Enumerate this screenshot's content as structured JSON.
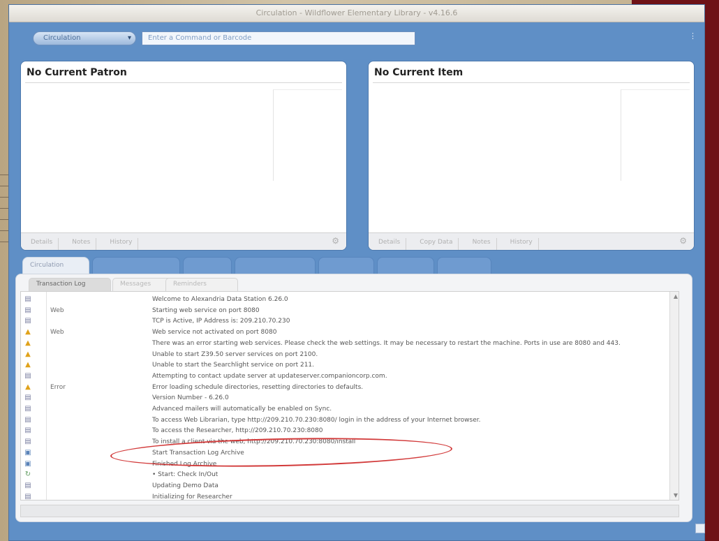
{
  "window": {
    "title": "Circulation - Wildflower Elementary Library - v4.16.6",
    "left_label": ""
  },
  "command_bar": {
    "select_label": "Circulation",
    "input_placeholder": "Enter a Command or Barcode",
    "more_icon": "ellipsis-icon"
  },
  "patron_panel": {
    "title": "No Current Patron",
    "buttons": [
      "Details",
      "Notes",
      "History"
    ],
    "gear_icon": "gear-icon"
  },
  "item_panel": {
    "title": "No Current Item",
    "buttons": [
      "Details",
      "Copy Data",
      "Notes",
      "History"
    ],
    "gear_icon": "gear-icon"
  },
  "tabs": [
    {
      "label": "Circulation",
      "active": true
    },
    {
      "label": "",
      "active": false
    },
    {
      "label": "",
      "active": false
    },
    {
      "label": "",
      "active": false
    },
    {
      "label": "",
      "active": false
    },
    {
      "label": "",
      "active": false
    },
    {
      "label": "",
      "active": false
    }
  ],
  "subtabs": [
    {
      "label": "Transaction Log",
      "active": true
    },
    {
      "label": "Messages",
      "active": false
    },
    {
      "label": "Reminders",
      "active": false
    }
  ],
  "log": [
    {
      "icon": "info-icon",
      "category": "",
      "message": "Welcome to Alexandria Data Station 6.26.0"
    },
    {
      "icon": "info-icon",
      "category": "Web",
      "message": "Starting web service on port 8080"
    },
    {
      "icon": "info-icon",
      "category": "",
      "message": "TCP is Active, IP Address is: 209.210.70.230"
    },
    {
      "icon": "warning-icon",
      "category": "Web",
      "message": "Web service not activated on port 8080"
    },
    {
      "icon": "warning-icon",
      "category": "",
      "message": "There was an error starting web services. Please check the web settings. It may be necessary to restart the machine. Ports in use are 8080 and 443."
    },
    {
      "icon": "warning-icon",
      "category": "",
      "message": "Unable to start Z39.50 server services on port 2100."
    },
    {
      "icon": "warning-icon",
      "category": "",
      "message": "Unable to start the Searchlight service on port 211."
    },
    {
      "icon": "info-icon",
      "category": "",
      "message": "Attempting to contact update server at updateserver.companioncorp.com."
    },
    {
      "icon": "warning-icon",
      "category": "Error",
      "message": "Error loading schedule directories, resetting directories to defaults."
    },
    {
      "icon": "info-icon",
      "category": "",
      "message": "Version Number - 6.26.0"
    },
    {
      "icon": "info-icon",
      "category": "",
      "message": "Advanced mailers will automatically be enabled on Sync."
    },
    {
      "icon": "info-icon",
      "category": "",
      "message": "To access Web Librarian, type http://209.210.70.230:8080/ login in the address of your Internet browser."
    },
    {
      "icon": "info-icon",
      "category": "",
      "message": "To access the Researcher, http://209.210.70.230:8080"
    },
    {
      "icon": "info-icon",
      "category": "",
      "message": "To install a client via the web, http://209.210.70.230:8080/install"
    },
    {
      "icon": "disk-icon",
      "category": "",
      "message": "Start Transaction Log Archive"
    },
    {
      "icon": "disk-icon",
      "category": "",
      "message": "Finished Log Archive"
    },
    {
      "icon": "checkout-icon",
      "category": "",
      "message": "• Start: Check In/Out"
    },
    {
      "icon": "info-icon",
      "category": "",
      "message": "Updating Demo Data"
    },
    {
      "icon": "info-icon",
      "category": "",
      "message": "Initializing for Researcher"
    }
  ],
  "annotation": {
    "color": "#d23a3a"
  },
  "colors": {
    "window_blue": "#5f8fc6",
    "panel_white": "#ffffff",
    "highlight_red": "#d23a3a"
  }
}
